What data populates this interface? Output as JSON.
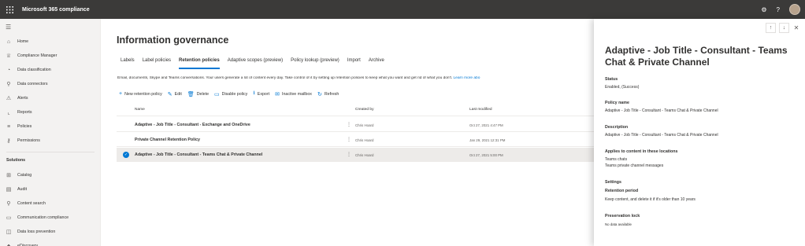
{
  "app": {
    "title": "Microsoft 365 compliance"
  },
  "topbar": {
    "icons": [
      "settings-icon",
      "help-icon",
      "avatar"
    ],
    "settings_glyph": "⚙",
    "help_glyph": "?"
  },
  "nav": {
    "items": [
      {
        "label": "Home",
        "icon": "home-icon",
        "glyph": "⌂"
      },
      {
        "label": "Compliance Manager",
        "icon": "trophy-icon",
        "glyph": "♕"
      },
      {
        "label": "Data classification",
        "icon": "classification-icon",
        "glyph": "◔"
      },
      {
        "label": "Data connectors",
        "icon": "connector-icon",
        "glyph": "⚲"
      },
      {
        "label": "Alerts",
        "icon": "alert-icon",
        "glyph": "⚠"
      },
      {
        "label": "Reports",
        "icon": "reports-icon",
        "glyph": "⌞"
      },
      {
        "label": "Policies",
        "icon": "policies-icon",
        "glyph": "≡"
      },
      {
        "label": "Permissions",
        "icon": "permissions-icon",
        "glyph": "⚷"
      }
    ],
    "section_label": "Solutions",
    "solutions": [
      {
        "label": "Catalog",
        "icon": "catalog-icon",
        "glyph": "⊞"
      },
      {
        "label": "Audit",
        "icon": "audit-icon",
        "glyph": "▤"
      },
      {
        "label": "Content search",
        "icon": "search-icon",
        "glyph": "⚲"
      },
      {
        "label": "Communication compliance",
        "icon": "chat-icon",
        "glyph": "▭"
      },
      {
        "label": "Data loss prevention",
        "icon": "dlp-icon",
        "glyph": "◫"
      },
      {
        "label": "eDiscovery",
        "icon": "ediscovery-icon",
        "glyph": "♣"
      }
    ]
  },
  "main": {
    "title": "Information governance",
    "tabs": [
      {
        "label": "Labels",
        "active": false
      },
      {
        "label": "Label policies",
        "active": false
      },
      {
        "label": "Retention policies",
        "active": true
      },
      {
        "label": "Adaptive scopes (preview)",
        "active": false
      },
      {
        "label": "Policy lookup (preview)",
        "active": false
      },
      {
        "label": "Import",
        "active": false
      },
      {
        "label": "Archive",
        "active": false
      }
    ],
    "description": "Email, documents, Skype and Teams conversations. Your users generate a lot of content every day. Take control of it by setting up retention policies to keep what you want and get rid of what you don't.",
    "learn_more": "Learn more abo",
    "toolbar": [
      {
        "label": "New retention policy",
        "icon": "add-icon",
        "glyph": "+"
      },
      {
        "label": "Edit",
        "icon": "edit-icon",
        "glyph": "✎"
      },
      {
        "label": "Delete",
        "icon": "delete-icon",
        "glyph": "🗑"
      },
      {
        "label": "Disable policy",
        "icon": "disable-icon",
        "glyph": "▭"
      },
      {
        "label": "Export",
        "icon": "export-icon",
        "glyph": "⭳"
      },
      {
        "label": "Inactive mailbox",
        "icon": "mail-icon",
        "glyph": "✉"
      },
      {
        "label": "Refresh",
        "icon": "refresh-icon",
        "glyph": "↻"
      }
    ],
    "table": {
      "headers": {
        "name": "Name",
        "created_by": "Created by",
        "last_modified": "Last modified"
      },
      "rows": [
        {
          "name": "Adaptive - Job Title - Consultant - Exchange and OneDrive",
          "created_by": "Chris Hoard",
          "last_modified": "Oct 27, 2021 4:47 PM",
          "selected": false
        },
        {
          "name": "Private Channel Retention Policy",
          "created_by": "Chris Hoard",
          "last_modified": "Jan 29, 2021 12:31 PM",
          "selected": false
        },
        {
          "name": "Adaptive - Job Title - Consultant - Teams Chat & Private Channel",
          "created_by": "Chris Hoard",
          "last_modified": "Oct 27, 2021 5:00 PM",
          "selected": true
        }
      ],
      "more_glyph": "⋮",
      "check_glyph": "✓"
    }
  },
  "panel": {
    "title": "Adaptive - Job Title - Consultant - Teams Chat & Private Channel",
    "nav_up_glyph": "↑",
    "nav_down_glyph": "↓",
    "close_glyph": "✕",
    "status_label": "Status",
    "status_value": "Enabled, (Success)",
    "policy_name_label": "Policy name",
    "policy_name_value": "Adaptive - Job Title - Consultant - Teams Chat & Private Channel",
    "description_label": "Description",
    "description_value": "Adaptive - Job Title - Consultant - Teams Chat & Private Channel",
    "applies_label": "Applies to content in these locations",
    "applies_values": [
      "Teams chats",
      "Teams private channel messages"
    ],
    "settings_label": "Settings",
    "retention_period_label": "Retention period",
    "retention_period_value": "Keep content, and delete it if it's older than 10 years",
    "preservation_lock_label": "Preservation lock",
    "preservation_lock_value": "No data available"
  }
}
